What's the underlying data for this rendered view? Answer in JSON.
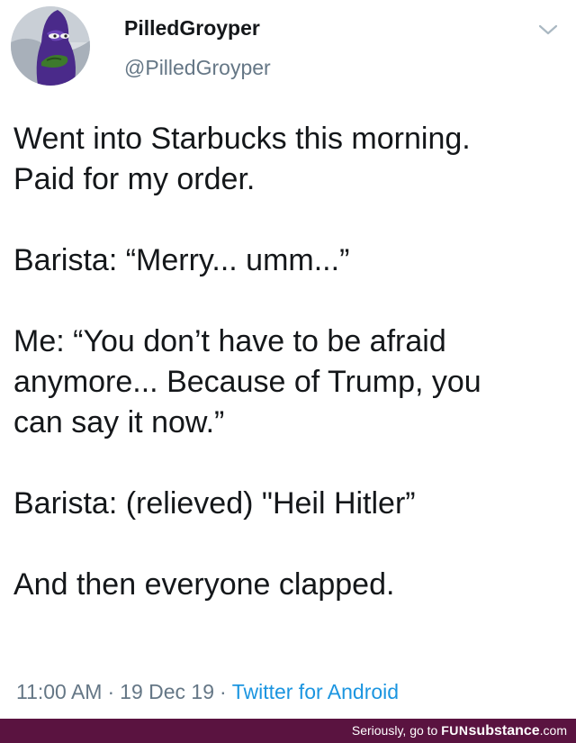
{
  "tweet": {
    "display_name": "PilledGroyper",
    "handle": "@PilledGroyper",
    "menu_icon": "chevron-down-icon",
    "paragraphs": [
      "Went into Starbucks this morning.\nPaid for my order.",
      "Barista: “Merry... umm...”",
      "Me: “You don’t have to be afraid\nanymore... Because of Trump, you\ncan say it now.”",
      "Barista: (relieved) \"Heil Hitler”",
      "And then everyone clapped."
    ],
    "time": "11:00 AM",
    "separator": "·",
    "date": "19 Dec 19",
    "source": "Twitter for Android"
  },
  "footer": {
    "prefix": "Seriously, go to ",
    "brand_fun": "FUN",
    "brand_substance": "substance",
    "brand_tld": ".com"
  },
  "colors": {
    "text": "#14171a",
    "muted": "#657786",
    "link": "#1b95e0",
    "footer_bg": "#5a1340"
  }
}
